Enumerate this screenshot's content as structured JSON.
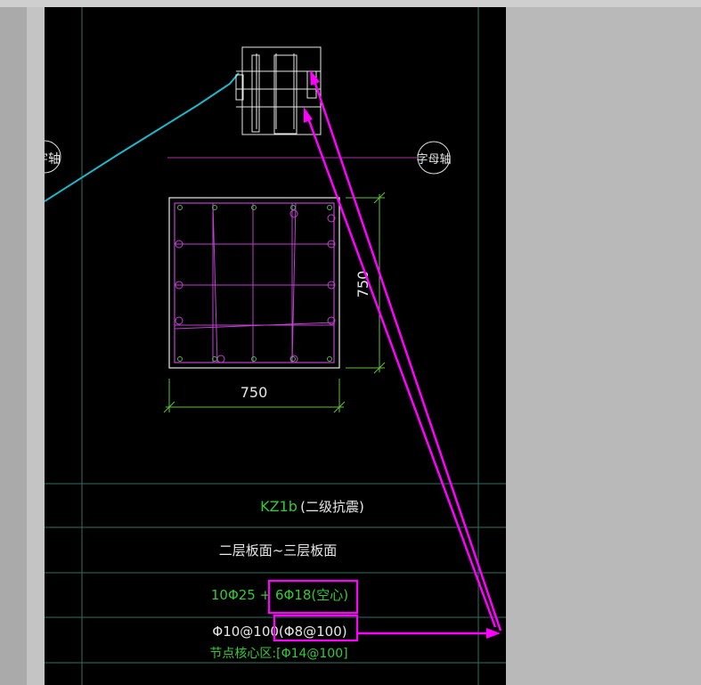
{
  "drawing": {
    "axis_bubble_left": "字轴",
    "axis_bubble_right": "字母轴",
    "dim_vertical": "750",
    "dim_horizontal": "750"
  },
  "table": {
    "column_name": "KZ1b",
    "seismic_grade": "(二级抗震)",
    "floor_range": "二层板面~三层板面",
    "rebar_main": "10Φ25 + 6Φ18(空心)",
    "stirrup": "Φ10@100(Φ8@100)",
    "joint_core": "节点核心区:[Φ14@100]"
  },
  "colors": {
    "background": "#000000",
    "grid": "#2f6f5f",
    "rebar": "#c040d0",
    "dim": "#60c040",
    "text_green": "#37c837",
    "text_white": "#e8e8e8",
    "magenta": "#ff00ff",
    "cyan": "#22b5c8"
  }
}
